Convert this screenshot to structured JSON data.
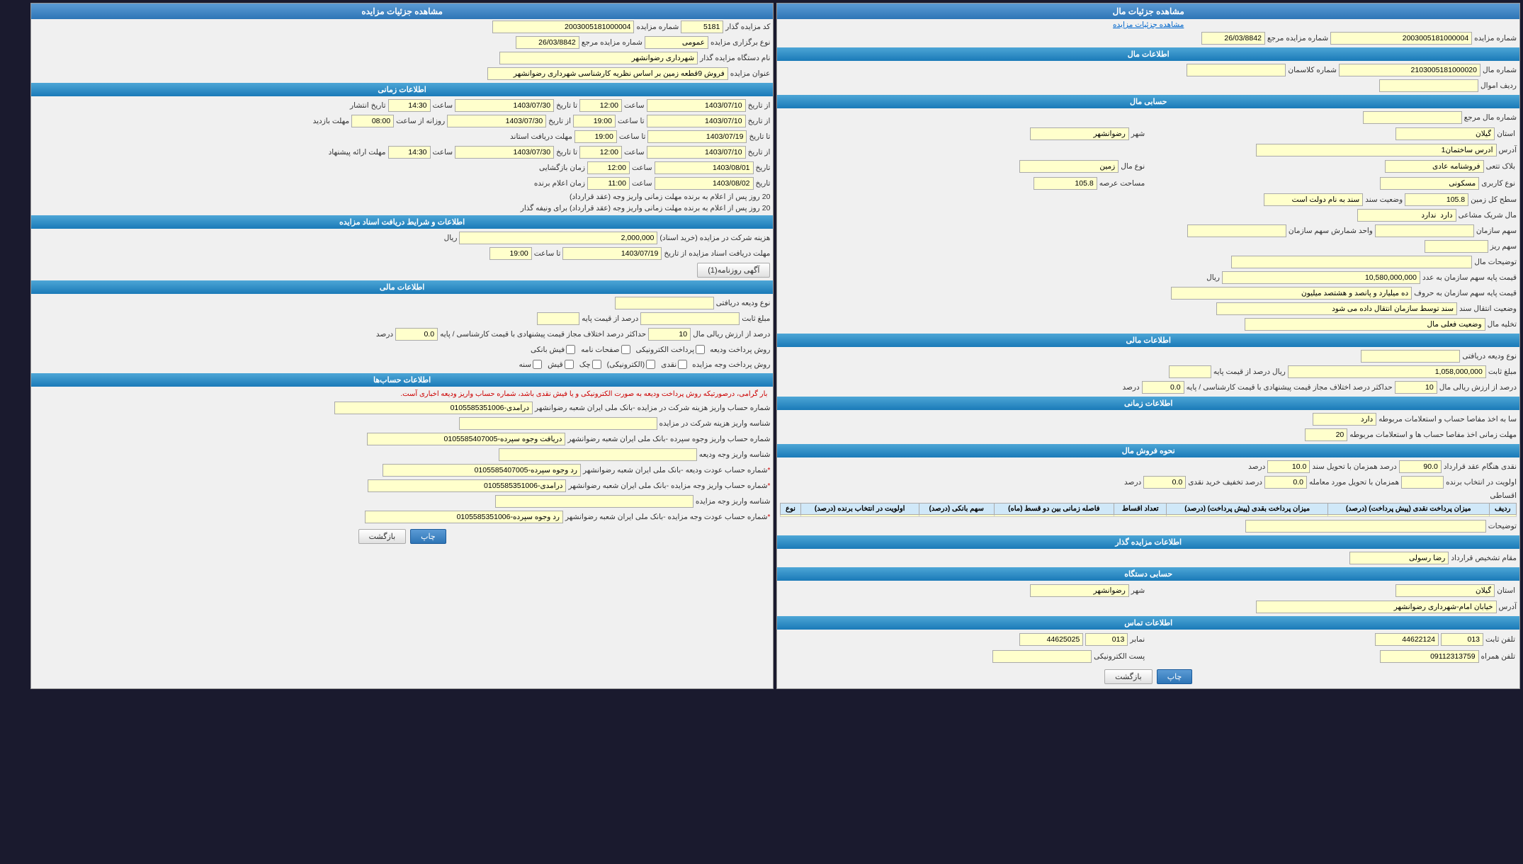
{
  "leftPanel": {
    "title": "مشاهده جزئیات مال",
    "subLink": "مشاهده جزئیات مزایده",
    "auctionNumber": "2003005181000004",
    "refNumber": "26/03/8842",
    "sections": {
      "malInfo": {
        "header": "اطلاعات مال",
        "malNumber": "2103005181000020",
        "malNumberLabel": "شماره مال",
        "classLabel": "شماره کلاسمان",
        "classValue": "",
        "assetLabel": "ردیف اموال",
        "assetValue": ""
      },
      "hesab": {
        "header": "حسابی مال",
        "malMarja": "شماره مال مرجع",
        "malMarjaValue": "",
        "ostan": "استان",
        "ostanValue": "گیلان",
        "shahr": "شهر",
        "shahrValue": "رضوانشهر",
        "address": "آدرس ساختمان1",
        "addressLabel": "آدرس",
        "blok": "بلاک تتعی",
        "blokValue": "فروشنامه عادی",
        "malType": "نوع مال",
        "malTypeValue": "زمین",
        "karabrdi": "نوع کاربری",
        "karabrdiValue": "مسکونی",
        "masahat": "مساحت عرصه",
        "masahatValue": "105.8",
        "masahatKol": "سطح کل زمین",
        "masahatKolValue": "105.8",
        "sanad": "وضعیت سند",
        "sanadValue": "سند به نام دولت است",
        "sharik": "مال شریک مشاعی",
        "sharikValue": "دارد  ندارد",
        "sahm": "سهم سازمان",
        "sahmValue": "",
        "vahed": "واحد شمارش سهم سازمان",
        "vahedValue": "",
        "sahmRiz": "سهم ریز",
        "sahmRizValue": "",
        "towzih": "توضیحات مال",
        "towzihValue": "",
        "qeymat": "قیمت پایه سهم سازمان به عدد",
        "qeymatValue": "10,580,000,000",
        "unit": "ریال",
        "qeymatHarf": "قیمت پایه سهم سازمان به حروف",
        "qeymatHarfValue": "ده میلیارد و پانصد و هشتصد میلیون",
        "vaziat": "وضعیت انتقال سند",
        "vaziatValue": "سند توسط سازمان انتقال داده می شود",
        "takhlie": "تخلیه مال",
        "takhlieValue": "وضعیت فعلی مال"
      },
      "mali": {
        "header": "اطلاعات مالی",
        "vazifType": "نوع ودیعه دریافتی",
        "vazifTypeValue": "",
        "mablag": "مبلغ ثابت",
        "mablagValue": "1,058,000,000",
        "unit": "ریال",
        "darsd": "درصد از قیمت پایه",
        "darsdValue": "",
        "darsad10": "10",
        "darsad10Label": "درصد از ارزش ریالی مال",
        "hadasghar": "حداکثر درصد اختلاف مجاز قیمت پیشنهادی با قیمت کارشناسی / پایه",
        "hadasgharValue": "0.0",
        "hadasgharUnit": "درصد"
      },
      "zamani": {
        "header": "اطلاعات زمانی",
        "hesab": "سا به اخذ مفاصا حساب و استعلامات مربوطه",
        "hesabValue": "دارد",
        "mohlat": "مهلت زمانی اخذ مفاصا حساب ها و استعلامات مربوطه",
        "mohlatValue": "20"
      },
      "forosh": {
        "header": "نحوه فروش مال",
        "naghd": "نقدی",
        "naghd1": "90.0",
        "naghd1Label": "هنگام عقد قرارداد",
        "naghd2": "10.0",
        "naghd2Label": "همزمان با تحویل سند",
        "naghd3": "",
        "naghd3Label": "اولویت در انتخاب برنده",
        "hamzaman": "0.0",
        "hamzamanLabel": "همزمان با تحویل مورد معامله",
        "takhlif": "0.0",
        "takhlfiLabel": "تخفیف خرید نقدی",
        "agsat": "اقساطی"
      },
      "tableHeader": {
        "col1": "ردیف",
        "col2": "میزان پرداخت نقدی (پیش پرداخت) (درصد)",
        "col3": "میزان پرداخت بقدی (پیش پرداخت) (درصد)",
        "col4": "تعداد اقساط",
        "col5": "فاصله زمانی بین دو قسط (ماه)",
        "col6": "سهم بانکی (درصد)",
        "col7": "اولویت در انتخاب برنده (درصد)",
        "col8": "نوع"
      },
      "mozayede": {
        "header": "اطلاعات مزایده گذار",
        "mokhtar": "مقام تشخیص قرارداد",
        "mokhtarValue": "رضا رسولی",
        "ostan": "استان",
        "ostanValue": "گیلان",
        "shahr": "شهر",
        "shahrValue": "رضوانشهر",
        "address": "آدرس",
        "addressValue": "خیابان امام-شهرداری رضوانشهر"
      },
      "tamas": {
        "header": "اطلاعات تماس",
        "telefon": "تلفن ثابت",
        "telefonValue": "44622124",
        "telefonCode": "013",
        "nambr": "نمابر",
        "nambrValue": "44625025",
        "nambrCode": "013",
        "hamrah": "تلفن همراه",
        "hamrahValue": "09112313759",
        "email": "پست الکترونیکی",
        "emailValue": ""
      }
    },
    "buttons": {
      "print": "چاپ",
      "back": "بازگشت"
    }
  },
  "rightPanel": {
    "title": "مشاهده جزئیات مزایده",
    "auctionCode": "5181",
    "auctionCodeLabel": "کد مزایده گذار",
    "auctionNumber": "2003005181000004",
    "auctionNumberLabel": "شماره مزایده",
    "auctionType": "عمومی",
    "auctionTypeLabel": "نوع برگزاری مزایده",
    "refNumber": "26/03/8842",
    "refNumberLabel": "شماره مزایده مرجع",
    "orgName": "شهرداری رضوانشهر",
    "orgNameLabel": "نام دستگاه مزایده گذار",
    "subject": "فروش 9قطعه زمین بر اساس نظریه کارشناسی شهرداری رضوانشهر",
    "subjectLabel": "عنوان مزایده",
    "zamani": {
      "header": "اطلاعات زمانی",
      "intesharFrom": "1403/07/10",
      "intesharFromLabel": "از تاریخ",
      "intesharFromTime": "12:00",
      "intesharFromTimeLabel": "ساعت",
      "intesharTo": "1403/07/30",
      "intesharToLabel": "تا تاریخ",
      "intesharToTime": "14:30",
      "intesharToTimeLabel": "ساعت",
      "barzgasht": "1403/07/10",
      "barzgashtLabel": "از تاریخ",
      "barzgashtTime": "19:00",
      "barzgashtTimeLabel": "تا ساعت",
      "barzgashtTo": "1403/07/30",
      "barzgashtToLabel": "از تاریخ",
      "barzgashtToTime": "08:00",
      "barzgashtToTimeLabel": "روزانه از ساعت",
      "mohlatEstelam": "1403/07/19",
      "mohlatEstelamLabel": "تا تاریخ",
      "mohlatEstelamTime": "19:00",
      "mohlatEstelamTimeLabel": "تا ساعت",
      "mohlatPishnahad": "1403/07/10",
      "mohlatPishahadLabel": "از تاریخ",
      "mohlatPishahadTime": "12:00",
      "mohlatPishahadTimeLabel": "ساعت",
      "mohlatPishahadTo": "1403/07/30",
      "mohlatPishahadToLabel": "تا تاریخ",
      "mohlatPishahadToTime": "14:30",
      "mohlatPishahadToTimeLabel": "ساعت",
      "barzgashiDate": "1403/08/01",
      "barzgashiDateLabel": "تاریخ",
      "barzgashiTime": "12:00",
      "barzgashiTimeLabel": "ساعت",
      "elamBarnde": "1403/08/02",
      "elamBarndeDateLabel": "تاریخ",
      "elamBarndeTime": "11:00",
      "elamBarndeTimeLabel": "ساعت",
      "mohlat20Label1": "مهلت زمانی واریز وجه (عقد قرارداد)",
      "mohlat20Value1": "20",
      "mohlat20Unit1": "روز پس از اعلام به برنده",
      "mohlat20Label2": "مهلت زمانی واریز وجه (عقد قرارداد) برای ونیفه گذار",
      "mohlat20Value2": "20",
      "mohlat20Unit2": "روز پس از اعلام به برنده"
    },
    "asnad": {
      "header": "اطلاعات و شرایط دریافت اسناد مزایده",
      "hezine": "هزینه شرکت در مزایده (خرید اسناد)",
      "hezineValue": "2,000,000",
      "unit": "ریال",
      "mohlat": "مهلت دریافت اسناد مزایده",
      "mohlatFrom": "1403/07/19",
      "mohlatTo": "19:00",
      "agohi": "آگهی روزنامه(1)"
    },
    "mali": {
      "header": "اطلاعات مالی",
      "vazifType": "نوع ودیعه دریافتی",
      "mablag": "مبلغ ثابت",
      "darsd": "درصد از قیمت پایه",
      "darsad10": "10",
      "darsad10Label": "درصد از ارزش ریالی مال",
      "hadasghar": "حداکثر درصد اختلاف مجاز قیمت پیشنهادی با قیمت کارشناسی / پایه",
      "hadasgharValue": "0.0",
      "hadasgharUnit": "درصد"
    },
    "pardakht": {
      "vajifLabel": "روش پرداخت ودیعه",
      "online": "پرداخت الکترونیکی",
      "check": "صفحات نامه",
      "fesh": "فیش بانکی",
      "vajhLabel": "روش پرداخت وجه مزایده",
      "naghd": "نقدی",
      "electronik": "(الکترونیکی)",
      "chek": "چک",
      "qesh": "قیش",
      "sene": "سنه"
    },
    "hesabat": {
      "header": "اطلاعات حساب‌ها",
      "note": "بار گرامی، درصورتیکه روش پرداخت ودیعه به صورت الکترونیکی و یا فیش نقدی باشد، شماره حساب واریز ودیعه اخباری آست.",
      "row1": "شماره حساب واریز هزینه شرکت در مزایده -بانک ملی ایران شعبه رضوانشهر",
      "row1Value": "درآمدی-0105585351006",
      "row2": "شناسه واریز هزینه شرکت در مزایده",
      "row2Value": "",
      "row3": "شماره حساب واریز وجوه سپرده -بانک ملی ایران شعبه رضوانشهر",
      "row3Value": "دریافت وجوه سپرده-0105585407005",
      "row4": "شناسه واریز وجه ودیعه",
      "row4Value": "",
      "row5": "شماره حساب عودت ودیعه -بانک ملی ایران شعبه رضوانشهر",
      "row5Value": "رد وجوه سپرده-0105585407005",
      "row6": "شماره حساب واریز وجه مزایده -بانک ملی ایران شعبه رضوانشهر",
      "row6Value": "درآمدی-0105585351006",
      "row7": "شناسه واریز وجه مزایده",
      "row7Value": "",
      "row8": "شماره حساب عودت وجه مزایده -بانک ملی ایران شعبه رضوانشهر",
      "row8Value": "رد وجوه سپرده-0105585351006"
    },
    "buttons": {
      "print": "چاپ",
      "back": "بازگشت"
    }
  }
}
